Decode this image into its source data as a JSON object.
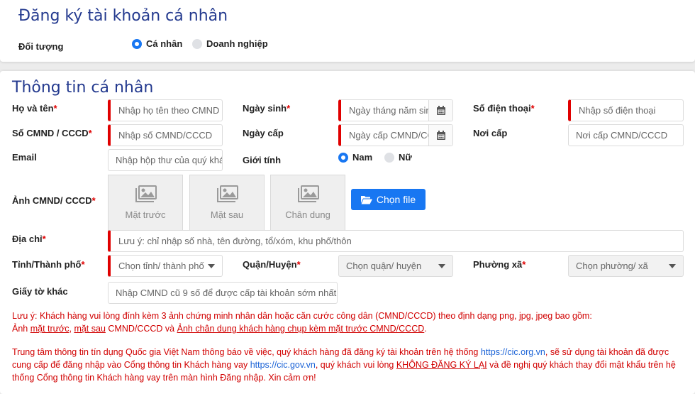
{
  "header": {
    "title": "Đăng ký tài khoản cá nhân",
    "target_label": "Đối tượng",
    "options": [
      {
        "label": "Cá nhân",
        "selected": true
      },
      {
        "label": "Doanh nghiệp",
        "selected": false
      }
    ]
  },
  "personal": {
    "section_title": "Thông tin cá nhân",
    "fullname": {
      "label": "Họ và tên",
      "placeholder": "Nhập họ tên theo CMND"
    },
    "birthdate": {
      "label": "Ngày sinh",
      "placeholder": "Ngày tháng năm sinh"
    },
    "phone": {
      "label": "Số điện thoại",
      "placeholder": "Nhập số điện thoại"
    },
    "id_number": {
      "label": "Số CMND / CCCD",
      "placeholder": "Nhập số CMND/CCCD"
    },
    "issue_date": {
      "label": "Ngày cấp",
      "placeholder": "Ngày cấp CMND/CCCD"
    },
    "issue_place": {
      "label": "Nơi cấp",
      "placeholder": "Nơi cấp CMND/CCCD"
    },
    "email": {
      "label": "Email",
      "placeholder": "Nhập hộp thư của quý khách"
    },
    "gender": {
      "label": "Giới tính",
      "options": [
        {
          "label": "Nam",
          "selected": true
        },
        {
          "label": "Nữ",
          "selected": false
        }
      ]
    },
    "photos": {
      "label": "Ảnh CMND/ CCCD",
      "front": "Mặt trước",
      "back": "Mặt sau",
      "portrait": "Chân dung",
      "button": "Chọn file"
    },
    "address": {
      "label": "Địa chỉ",
      "placeholder": "Lưu ý: chỉ nhập số nhà, tên đường, tổ/xóm, khu phố/thôn"
    },
    "province": {
      "label": "Tỉnh/Thành phố",
      "placeholder": "Chọn tỉnh/ thành phố"
    },
    "district": {
      "label": "Quận/Huyện",
      "placeholder": "Chọn quận/ huyện"
    },
    "ward": {
      "label": "Phường xã",
      "placeholder": "Chọn phường/ xã"
    },
    "other_docs": {
      "label": "Giấy tờ khác",
      "placeholder": "Nhập CMND cũ 9 số để được cấp tài khoản sớm nhất"
    }
  },
  "notes": {
    "n1_line1": "Lưu ý: Khách hàng vui lòng đính kèm 3 ảnh chứng minh nhân dân hoặc căn cước công dân (CMND/CCCD) theo định dạng png, jpg, jpeg bao gồm:",
    "n1_a": "Ảnh ",
    "n1_front": "mặt trước",
    "n1_b": ", ",
    "n1_back": "mặt sau",
    "n1_c": " CMND/CCCD và ",
    "n1_portrait": "Ảnh chân dung khách hàng chụp kèm mặt trước CMND/CCCD",
    "n1_d": ".",
    "n2_a": "Trung tâm thông tin tín dụng Quốc gia Việt Nam thông báo về việc, quý khách hàng đã đăng ký tài khoản trên hệ thống ",
    "n2_link1": "https://cic.org.vn",
    "n2_b": ", sẽ sử dụng tài khoản đã được",
    "n2_c": "cung cấp để đăng nhập vào Cổng thông tin Khách hàng vay ",
    "n2_link2": "https://cic.gov.vn",
    "n2_d": ", quý khách vui lòng ",
    "n2_strong": "KHÔNG ĐĂNG KÝ LẠI",
    "n2_e": " và đề nghị quý khách thay đổi mật khẩu trên hệ",
    "n2_f": "thống Cổng thông tin Khách hàng vay trên màn hình Đăng nhập. Xin cảm ơn!"
  },
  "required_mark": "*",
  "colors": {
    "accent": "#1877f2",
    "title": "#243a8f",
    "required": "#e00000"
  }
}
